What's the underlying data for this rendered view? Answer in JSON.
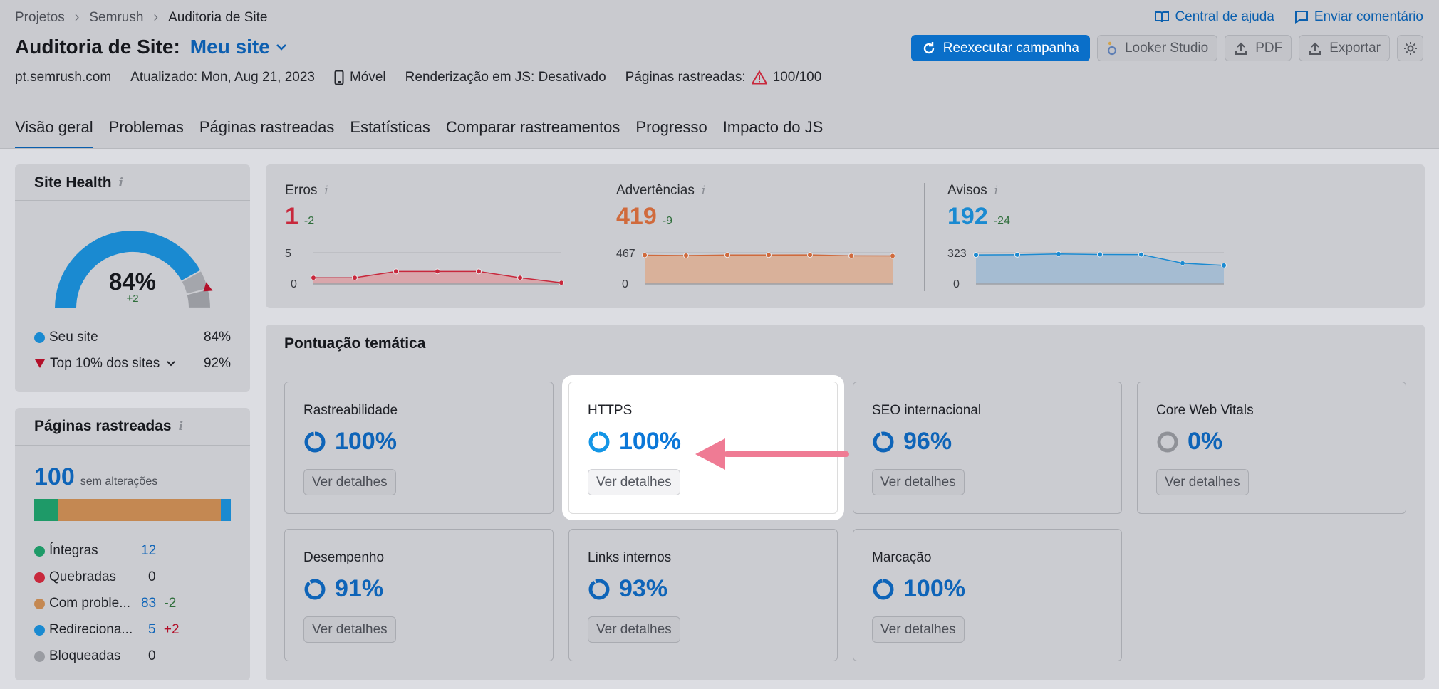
{
  "breadcrumb": [
    "Projetos",
    "Semrush",
    "Auditoria de Site"
  ],
  "top_links": {
    "help": "Central de ajuda",
    "feedback": "Enviar comentário"
  },
  "title": "Auditoria de Site:",
  "project": "Meu site",
  "actions": {
    "rerun": "Reexecutar campanha",
    "looker": "Looker Studio",
    "pdf": "PDF",
    "export": "Exportar"
  },
  "meta": {
    "domain": "pt.semrush.com",
    "updated": "Atualizado: Mon, Aug 21, 2023",
    "device": "Móvel",
    "js": "Renderização em JS: Desativado",
    "crawled_label": "Páginas rastreadas:",
    "crawled_value": "100/100"
  },
  "tabs": [
    "Visão geral",
    "Problemas",
    "Páginas rastreadas",
    "Estatísticas",
    "Comparar rastreamentos",
    "Progresso",
    "Impacto do JS"
  ],
  "site_health": {
    "title": "Site Health",
    "score": "84%",
    "delta": "+2",
    "score_fraction": 0.84,
    "top_fraction": 0.92,
    "legend": [
      {
        "label": "Seu site",
        "value": "84%",
        "color": "#1a8ad1"
      },
      {
        "label": "Top 10% dos sites",
        "value": "92%",
        "color": "#b3102a"
      }
    ]
  },
  "crawled": {
    "title": "Páginas rastreadas",
    "total": "100",
    "total_note": "sem alterações",
    "rows": [
      {
        "label": "Íntegras",
        "value": "12",
        "delta": "",
        "color": "#1e9a68",
        "count": 12
      },
      {
        "label": "Quebradas",
        "value": "0",
        "delta": "",
        "color": "#c8283c",
        "count": 0
      },
      {
        "label": "Com proble...",
        "value": "83",
        "delta": "-2",
        "color": "#c48852",
        "count": 83
      },
      {
        "label": "Redireciona...",
        "value": "5",
        "delta": "+2",
        "color": "#1a8ad1",
        "count": 5
      },
      {
        "label": "Bloqueadas",
        "value": "0",
        "delta": "",
        "color": "#9a9ca2",
        "count": 0
      }
    ]
  },
  "issues": [
    {
      "label": "Erros",
      "value": "1",
      "delta": "-2",
      "color": "#c8283c",
      "fill": "#d9a6ab",
      "ymax_label": "5",
      "ymin_label": "0",
      "ymax": 5,
      "series": [
        1,
        1,
        2,
        2,
        2,
        1,
        0.2
      ]
    },
    {
      "label": "Advertências",
      "value": "419",
      "delta": "-9",
      "color": "#d06a3c",
      "fill": "#d9b19a",
      "ymax_label": "467",
      "ymin_label": "0",
      "ymax": 467,
      "series": [
        430,
        425,
        432,
        432,
        434,
        420,
        419
      ]
    },
    {
      "label": "Avisos",
      "value": "192",
      "delta": "-24",
      "color": "#1a8ad1",
      "fill": "#a5bcd2",
      "ymax_label": "323",
      "ymin_label": "0",
      "ymax": 323,
      "series": [
        300,
        302,
        310,
        305,
        304,
        215,
        192
      ]
    }
  ],
  "thematic": {
    "title": "Pontuação temática",
    "button": "Ver detalhes",
    "tiles": [
      {
        "name": "Rastreabilidade",
        "score": "100%",
        "fraction": 1.0
      },
      {
        "name": "HTTPS",
        "score": "100%",
        "fraction": 1.0
      },
      {
        "name": "SEO internacional",
        "score": "96%",
        "fraction": 0.96
      },
      {
        "name": "Core Web Vitals",
        "score": "0%",
        "fraction": 0.0
      },
      {
        "name": "Desempenho",
        "score": "91%",
        "fraction": 0.91
      },
      {
        "name": "Links internos",
        "score": "93%",
        "fraction": 0.93
      },
      {
        "name": "Marcação",
        "score": "100%",
        "fraction": 1.0
      }
    ]
  }
}
